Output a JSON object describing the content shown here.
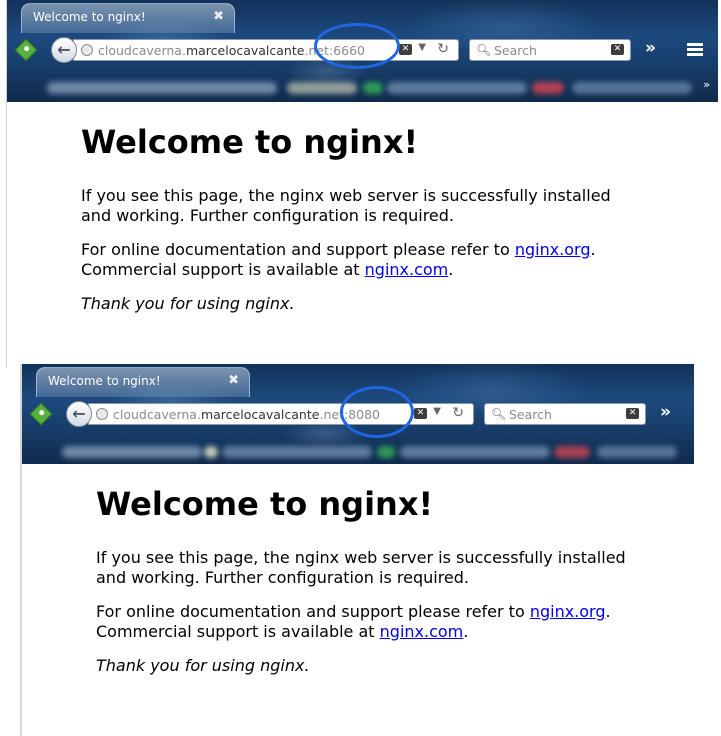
{
  "screenshots": [
    {
      "tab_title": "Welcome to nginx!",
      "tab_close": "✖",
      "url": {
        "prefix": "cloudcaverna.",
        "domain": "marcelocavalcante",
        "dot": ".",
        "tld": "net",
        "port": ":6660"
      },
      "search_placeholder": "Search",
      "highlight_color": "#1f66e0"
    },
    {
      "tab_title": "Welcome to nginx!",
      "tab_close": "✖",
      "url": {
        "prefix": "cloudcaverna.",
        "domain": "marcelocavalcante",
        "dot": ".",
        "tld": "net",
        "port": ":8080"
      },
      "search_placeholder": "Search",
      "highlight_color": "#1f66e0"
    }
  ],
  "page": {
    "heading": "Welcome to nginx!",
    "p1_line1": "If you see this page, the nginx web server is successfully installed",
    "p1_line2": "and working. Further configuration is required.",
    "p2_line1_pre": "For online documentation and support please refer to ",
    "p2_link1": "nginx.org",
    "p2_line1_post": ".",
    "p2_line2_pre": "Commercial support is available at ",
    "p2_link2": "nginx.com",
    "p2_line2_post": ".",
    "thanks": "Thank you for using nginx."
  },
  "icons": [
    "addon-icon",
    "back-arrow-icon",
    "globe-icon",
    "clear-icon",
    "dropdown-icon",
    "reload-icon",
    "search-icon",
    "chevron-right-icon",
    "hamburger-menu-icon"
  ]
}
